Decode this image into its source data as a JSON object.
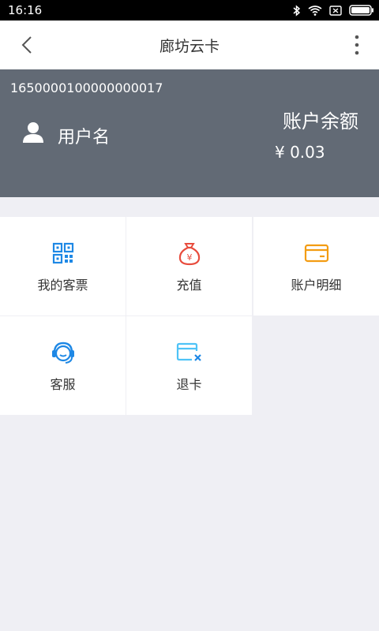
{
  "status_bar": {
    "time": "16:16",
    "icons": [
      "bluetooth-icon",
      "wifi-icon",
      "sim-icon",
      "battery-icon"
    ]
  },
  "app_bar": {
    "title": "廊坊云卡",
    "back_icon": "chevron-left-icon",
    "more_icon": "more-vertical-icon"
  },
  "account": {
    "card_number": "1650000100000000017",
    "user_name": "用户名",
    "balance_label": "账户余额",
    "balance_value": "¥ 0.03",
    "background_color": "#626a75"
  },
  "menu": {
    "items": [
      {
        "label": "我的客票",
        "icon": "qr-code-icon",
        "color": "#1e88e5"
      },
      {
        "label": "充值",
        "icon": "money-bag-icon",
        "color": "#e84c3d"
      },
      {
        "label": "账户明细",
        "icon": "card-icon",
        "color": "#f39c12"
      },
      {
        "label": "客服",
        "icon": "customer-service-icon",
        "color": "#1e88e5"
      },
      {
        "label": "退卡",
        "icon": "card-cancel-icon",
        "color": "#4fc3f7"
      }
    ]
  }
}
